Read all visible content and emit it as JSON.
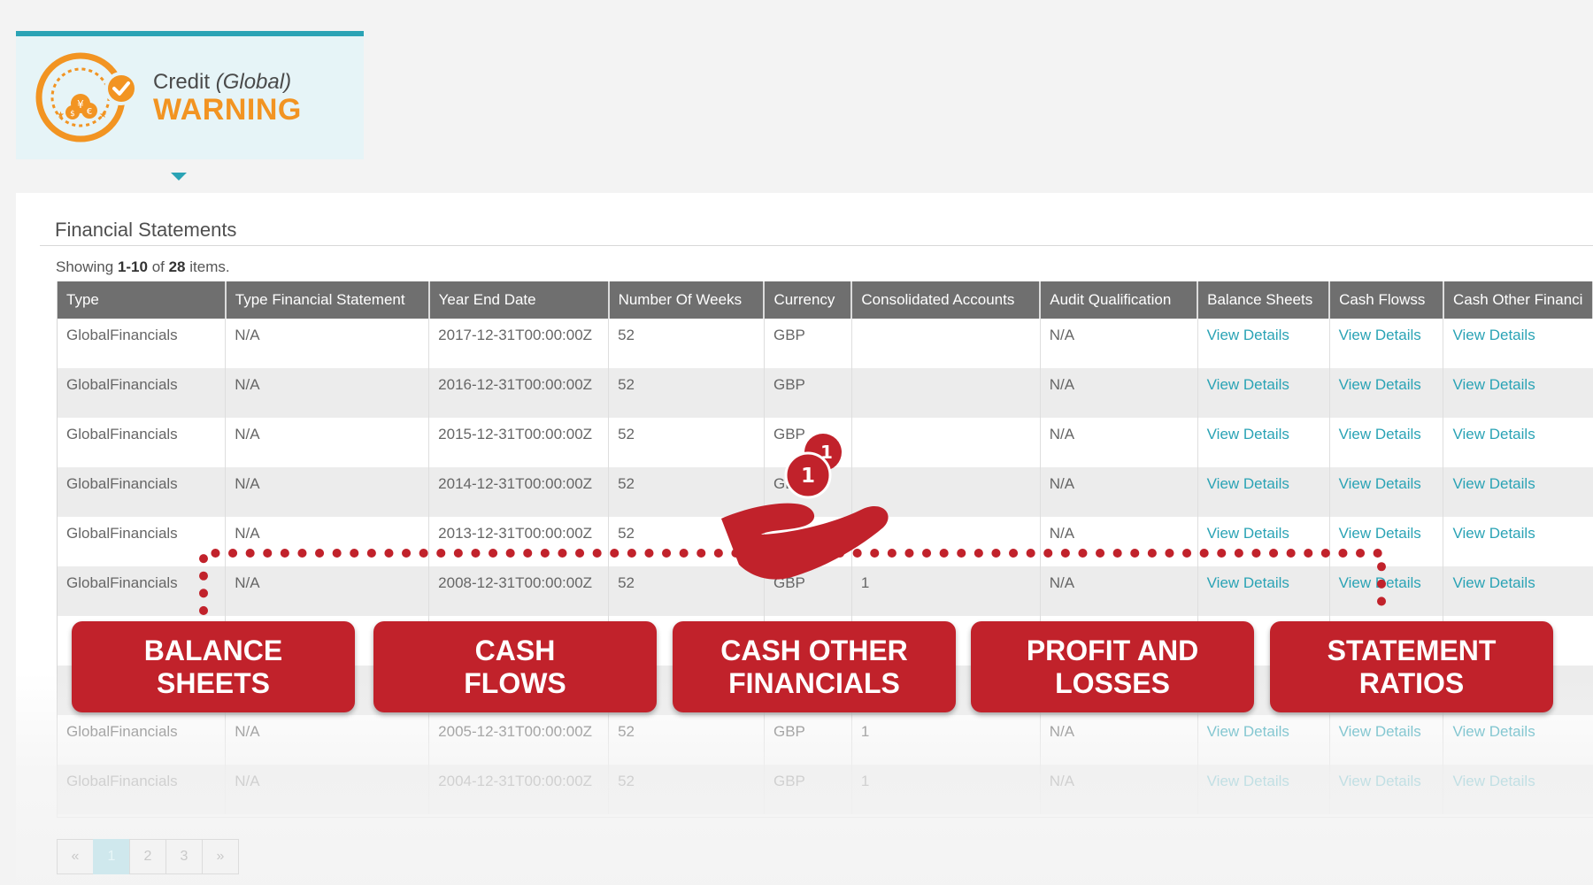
{
  "status": {
    "title": "Credit",
    "title_suffix": "(Global)",
    "level": "WARNING",
    "accent_color": "#f29422",
    "border_color": "#2aa3b5"
  },
  "section": {
    "title": "Financial Statements",
    "summary": {
      "prefix": "Showing ",
      "range": "1-10",
      "of": " of ",
      "total": "28",
      "suffix": " items."
    }
  },
  "table": {
    "headers": [
      "Type",
      "Type Financial Statement",
      "Year End Date",
      "Number Of Weeks",
      "Currency",
      "Consolidated Accounts",
      "Audit Qualification",
      "Balance Sheets",
      "Cash Flowss",
      "Cash Other Financi"
    ],
    "rows": [
      [
        "GlobalFinancials",
        "N/A",
        "2017-12-31T00:00:00Z",
        "52",
        "GBP",
        "",
        "N/A",
        "View Details",
        "View Details",
        "View Details"
      ],
      [
        "GlobalFinancials",
        "N/A",
        "2016-12-31T00:00:00Z",
        "52",
        "GBP",
        "",
        "N/A",
        "View Details",
        "View Details",
        "View Details"
      ],
      [
        "GlobalFinancials",
        "N/A",
        "2015-12-31T00:00:00Z",
        "52",
        "GBP",
        "",
        "N/A",
        "View Details",
        "View Details",
        "View Details"
      ],
      [
        "GlobalFinancials",
        "N/A",
        "2014-12-31T00:00:00Z",
        "52",
        "GBP",
        "",
        "N/A",
        "View Details",
        "View Details",
        "View Details"
      ],
      [
        "GlobalFinancials",
        "N/A",
        "2013-12-31T00:00:00Z",
        "52",
        "",
        "",
        "N/A",
        "View Details",
        "View Details",
        "View Details"
      ],
      [
        "GlobalFinancials",
        "N/A",
        "2008-12-31T00:00:00Z",
        "52",
        "GBP",
        "1",
        "N/A",
        "View Details",
        "View Details",
        "View Details"
      ],
      [
        "",
        "",
        "",
        "",
        "",
        "",
        "",
        "",
        "",
        ""
      ],
      [
        "",
        "",
        "",
        "",
        "",
        "",
        "",
        "",
        "",
        ""
      ],
      [
        "GlobalFinancials",
        "N/A",
        "2005-12-31T00:00:00Z",
        "52",
        "GBP",
        "1",
        "N/A",
        "View Details",
        "View Details",
        "View Details"
      ],
      [
        "GlobalFinancials",
        "N/A",
        "2004-12-31T00:00:00Z",
        "52",
        "GBP",
        "1",
        "N/A",
        "View Details",
        "View Details",
        "View Details"
      ]
    ]
  },
  "pagination": {
    "prev": "«",
    "pages": [
      "1",
      "2",
      "3"
    ],
    "next": "»",
    "active": "1"
  },
  "promo": {
    "coin_numeral": "1",
    "tags": [
      [
        "BALANCE",
        "SHEETS"
      ],
      [
        "CASH",
        "FLOWS"
      ],
      [
        "CASH OTHER",
        "FINANCIALS"
      ],
      [
        "PROFIT AND",
        "LOSSES"
      ],
      [
        "STATEMENT",
        "RATIOS"
      ]
    ],
    "tag_color": "#c1222b"
  }
}
